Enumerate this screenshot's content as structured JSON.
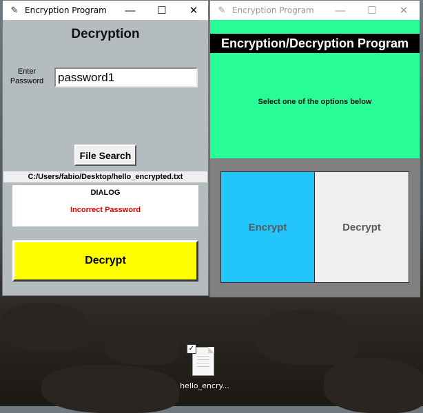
{
  "left_window": {
    "title": "Encryption Program",
    "minimize_glyph": "—",
    "maximize_glyph": "☐",
    "close_glyph": "✕",
    "heading": "Decryption",
    "enter_password_label": "Enter\nPassword",
    "password_value": "password1",
    "file_search_label": "File Search",
    "file_path": "C:/Users/fabio/Desktop/hello_encrypted.txt",
    "dialog_title": "DIALOG",
    "dialog_message": "Incorrect Password",
    "decrypt_button_label": "Decrypt"
  },
  "right_window": {
    "title": "Encryption Program",
    "minimize_glyph": "—",
    "maximize_glyph": "☐",
    "close_glyph": "✕",
    "heading": "Encryption/Decryption Program",
    "instruction": "Select one of the options below",
    "encrypt_option_label": "Encrypt",
    "decrypt_option_label": "Decrypt"
  },
  "desktop_icon": {
    "label": "hello_encry...",
    "checkbox_glyph": "✓"
  },
  "colors": {
    "left_bg": "#b4bcc0",
    "decrypt_button": "#ffff00",
    "error_text": "#e00000",
    "green_panel": "#29fd98",
    "encrypt_option": "#22c6fc",
    "decrypt_option": "#efefef"
  },
  "icons": {
    "app_icon": "feather-icon",
    "file_icon": "text-file-icon"
  }
}
